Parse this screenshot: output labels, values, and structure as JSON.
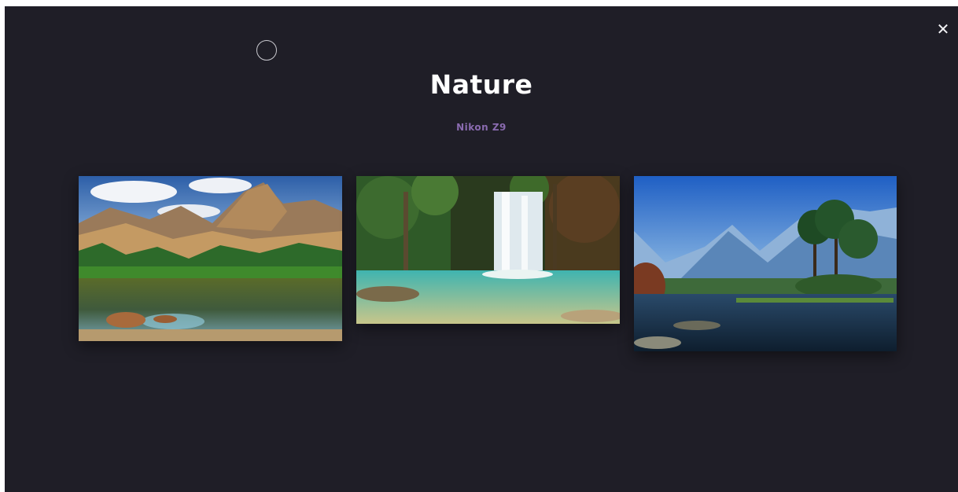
{
  "gallery": {
    "title": "Nature",
    "camera": "Nikon Z9",
    "close_label": "✕",
    "photos": [
      {
        "subject": "mountain-lake"
      },
      {
        "subject": "waterfall-lagoon"
      },
      {
        "subject": "island-lake-mountains"
      }
    ]
  },
  "colors": {
    "background": "#1f1e27",
    "title": "#ffffff",
    "subtitle": "#8a6bb0"
  }
}
